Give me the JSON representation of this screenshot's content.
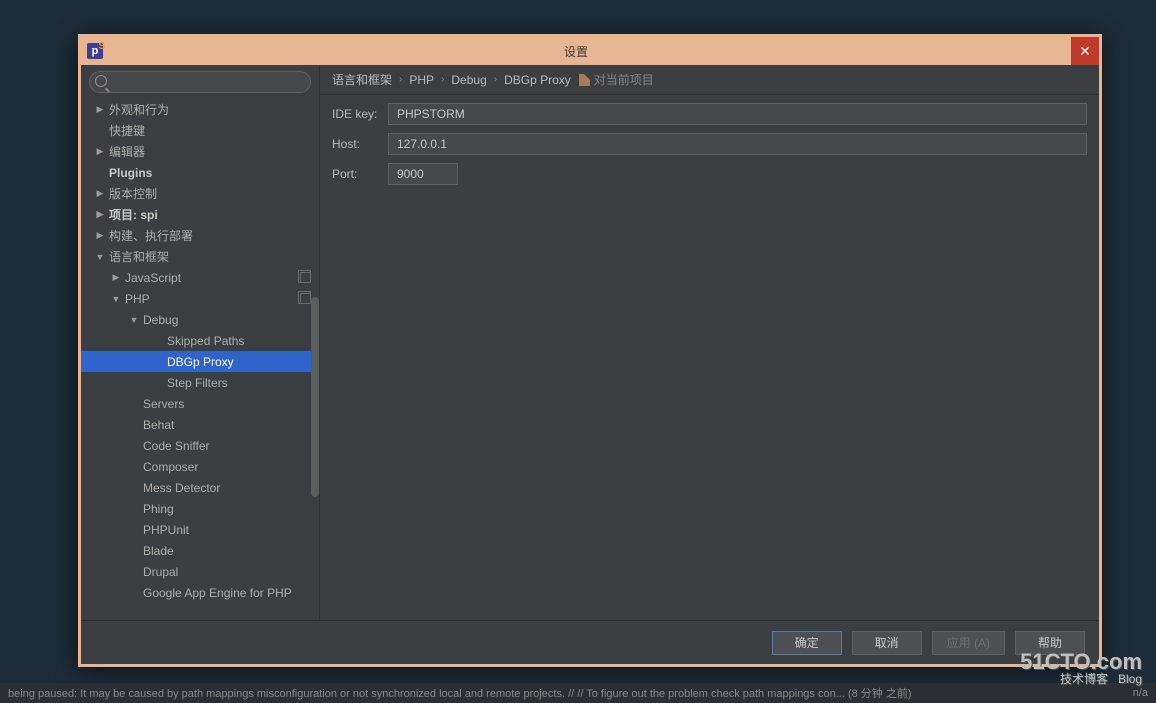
{
  "window": {
    "title": "设置"
  },
  "search": {
    "placeholder": ""
  },
  "tree": [
    {
      "lvl": 1,
      "arrow": "▶",
      "label": "外观和行为",
      "bold": false
    },
    {
      "lvl": 1,
      "arrow": "",
      "label": "快捷键",
      "bold": false
    },
    {
      "lvl": 1,
      "arrow": "▶",
      "label": "编辑器",
      "bold": false
    },
    {
      "lvl": 1,
      "arrow": "",
      "label": "Plugins",
      "bold": true
    },
    {
      "lvl": 1,
      "arrow": "▶",
      "label": "版本控制",
      "bold": false
    },
    {
      "lvl": 1,
      "arrow": "▶",
      "label": "项目: spi",
      "bold": true
    },
    {
      "lvl": 1,
      "arrow": "▶",
      "label": "构建、执行部署",
      "bold": false
    },
    {
      "lvl": 1,
      "arrow": "▼",
      "label": "语言和框架",
      "bold": false
    },
    {
      "lvl": 2,
      "arrow": "▶",
      "label": "JavaScript",
      "bold": false,
      "copy": true
    },
    {
      "lvl": 2,
      "arrow": "▼",
      "label": "PHP",
      "bold": false,
      "copy": true
    },
    {
      "lvl": 3,
      "arrow": "▼",
      "label": "Debug",
      "bold": false
    },
    {
      "lvl": 4,
      "arrow": "",
      "label": "Skipped Paths",
      "bold": false
    },
    {
      "lvl": 4,
      "arrow": "",
      "label": "DBGp Proxy",
      "bold": false,
      "selected": true
    },
    {
      "lvl": 4,
      "arrow": "",
      "label": "Step Filters",
      "bold": false
    },
    {
      "lvl": 3,
      "arrow": "",
      "label": "Servers",
      "bold": false
    },
    {
      "lvl": 3,
      "arrow": "",
      "label": "Behat",
      "bold": false
    },
    {
      "lvl": 3,
      "arrow": "",
      "label": "Code Sniffer",
      "bold": false
    },
    {
      "lvl": 3,
      "arrow": "",
      "label": "Composer",
      "bold": false
    },
    {
      "lvl": 3,
      "arrow": "",
      "label": "Mess Detector",
      "bold": false
    },
    {
      "lvl": 3,
      "arrow": "",
      "label": "Phing",
      "bold": false
    },
    {
      "lvl": 3,
      "arrow": "",
      "label": "PHPUnit",
      "bold": false
    },
    {
      "lvl": 3,
      "arrow": "",
      "label": "Blade",
      "bold": false
    },
    {
      "lvl": 3,
      "arrow": "",
      "label": "Drupal",
      "bold": false
    },
    {
      "lvl": 3,
      "arrow": "",
      "label": "Google App Engine for PHP",
      "bold": false
    }
  ],
  "breadcrumb": {
    "parts": [
      "语言和框架",
      "PHP",
      "Debug",
      "DBGp Proxy"
    ],
    "project_label": "对当前项目"
  },
  "form": {
    "ide_key": {
      "label": "IDE key:",
      "value": "PHPSTORM"
    },
    "host": {
      "label": "Host:",
      "value": "127.0.0.1"
    },
    "port": {
      "label": "Port:",
      "value": "9000"
    }
  },
  "buttons": {
    "ok": "确定",
    "cancel": "取消",
    "apply": "应用 (A)",
    "help": "帮助"
  },
  "status": {
    "msg": "being paused: It may be caused by path mappings misconfiguration or not synchronized local and remote projects. // // To figure out the problem check path mappings con... (8 分钟 之前)",
    "right": "n/a"
  },
  "watermark": {
    "line1": "51CTO.com",
    "line2a": "技术博客",
    "line2b": "Blog"
  }
}
